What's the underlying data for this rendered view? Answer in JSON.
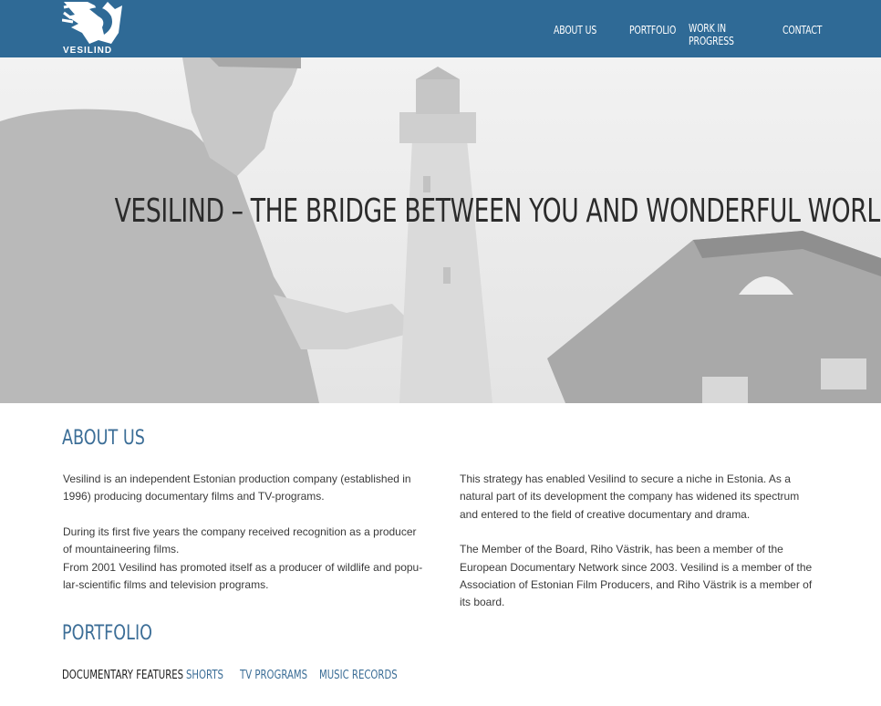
{
  "brand": {
    "logo_text": "VESILIND"
  },
  "nav": {
    "items": [
      {
        "label": "ABOUT US"
      },
      {
        "label": "PORTFOLIO"
      },
      {
        "label": "WORK IN PROGRESS"
      },
      {
        "label": "CONTACT"
      }
    ]
  },
  "hero": {
    "headline": "VESILIND – THE BRIDGE BETWEEN YOU AND WONDERFUL WORLDS."
  },
  "about": {
    "title": "ABOUT US",
    "left": {
      "p1": "Vesilind is an independent Estonian production company (established in 1996) producing documentary films and TV-programs.",
      "p2a": "During its first five years the company received recognition as a producer of mountaineering films.",
      "p2b": "From 2001 Vesilind has promoted itself as a producer of wildlife and popu-lar-scientific films and television programs."
    },
    "right": {
      "p1": "This strategy has enabled Vesilind to secure a niche in Estonia. As a natural part of its development the company has widened its spectrum and entered to the field of creative documentary and drama.",
      "p2": "The Member of the Board, Riho Västrik, has been a member of the European Documentary Network since 2003. Vesilind is a member of the Association of Estonian Film Producers, and Riho Västrik is a member of its board."
    }
  },
  "portfolio": {
    "title": "PORTFOLIO",
    "tabs": [
      {
        "label": "DOCUMENTARY FEATURES"
      },
      {
        "label": "SHORTS"
      },
      {
        "label": "TV PROGRAMS"
      },
      {
        "label": "MUSIC RECORDS"
      }
    ]
  },
  "colors": {
    "header_bg": "#2f6a96",
    "accent": "#3c6e97",
    "active_tab": "#1f1f1f"
  }
}
